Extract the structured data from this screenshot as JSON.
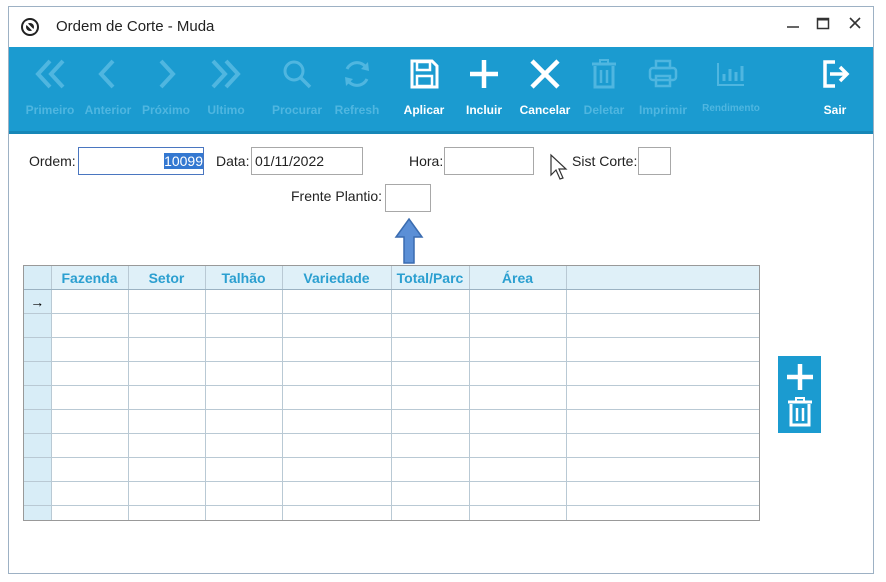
{
  "window": {
    "title": "Ordem de Corte - Muda",
    "controls": [
      "minimize-icon",
      "maximize-icon",
      "close-icon"
    ]
  },
  "toolbar": {
    "buttons": [
      {
        "id": "primeiro",
        "label": "Primeiro",
        "icon": "double-chevron-left-icon",
        "enabled": false
      },
      {
        "id": "anterior",
        "label": "Anterior",
        "icon": "chevron-left-icon",
        "enabled": false
      },
      {
        "id": "proximo",
        "label": "Próximo",
        "icon": "chevron-right-icon",
        "enabled": false
      },
      {
        "id": "ultimo",
        "label": "Ultimo",
        "icon": "double-chevron-right-icon",
        "enabled": false
      },
      {
        "id": "procurar",
        "label": "Procurar",
        "icon": "search-icon",
        "enabled": false
      },
      {
        "id": "refresh",
        "label": "Refresh",
        "icon": "refresh-icon",
        "enabled": false
      },
      {
        "id": "aplicar",
        "label": "Aplicar",
        "icon": "save-icon",
        "enabled": true
      },
      {
        "id": "incluir",
        "label": "Incluir",
        "icon": "plus-icon",
        "enabled": true
      },
      {
        "id": "cancelar",
        "label": "Cancelar",
        "icon": "x-icon",
        "enabled": true
      },
      {
        "id": "deletar",
        "label": "Deletar",
        "icon": "trash-icon",
        "enabled": false
      },
      {
        "id": "imprimir",
        "label": "Imprimir",
        "icon": "printer-icon",
        "enabled": false
      },
      {
        "id": "rendimento",
        "label": "Rendimento",
        "icon": "bar-chart-icon",
        "enabled": false
      },
      {
        "id": "sair",
        "label": "Sair",
        "icon": "exit-icon",
        "enabled": true
      }
    ],
    "enabled_color": "#ffffff",
    "disabled_color": "#4fb6e0",
    "background": "#1b9bd0"
  },
  "form": {
    "ordem": {
      "label": "Ordem:",
      "value": "10099"
    },
    "data": {
      "label": "Data:",
      "value": "01/11/2022"
    },
    "hora": {
      "label": "Hora:",
      "value": ""
    },
    "sist_corte": {
      "label": "Sist Corte:",
      "value": ""
    },
    "frente_plantio": {
      "label": "Frente Plantio:",
      "value": ""
    }
  },
  "grid": {
    "columns": [
      "Fazenda",
      "Setor",
      "Talhão",
      "Variedade",
      "Total/Parc",
      "Área"
    ],
    "current_row_indicator": "→",
    "rows": [
      [
        "",
        "",
        "",
        "",
        "",
        ""
      ],
      [
        "",
        "",
        "",
        "",
        "",
        ""
      ],
      [
        "",
        "",
        "",
        "",
        "",
        ""
      ],
      [
        "",
        "",
        "",
        "",
        "",
        ""
      ],
      [
        "",
        "",
        "",
        "",
        "",
        ""
      ],
      [
        "",
        "",
        "",
        "",
        "",
        ""
      ],
      [
        "",
        "",
        "",
        "",
        "",
        ""
      ],
      [
        "",
        "",
        "",
        "",
        "",
        ""
      ],
      [
        "",
        "",
        "",
        "",
        "",
        ""
      ],
      [
        "",
        "",
        "",
        "",
        "",
        ""
      ]
    ],
    "header_text_color": "#2b9fd0"
  },
  "side_panel": {
    "buttons": [
      {
        "icon": "plus-icon"
      },
      {
        "icon": "trash-icon"
      }
    ]
  }
}
